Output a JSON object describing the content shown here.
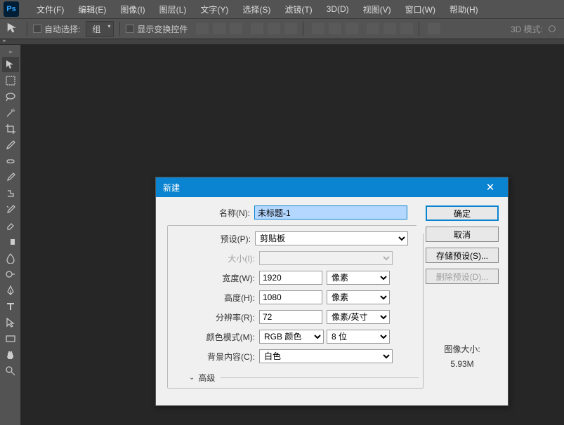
{
  "app": {
    "logo": "Ps"
  },
  "menu": [
    "文件(F)",
    "编辑(E)",
    "图像(I)",
    "图层(L)",
    "文字(Y)",
    "选择(S)",
    "滤镜(T)",
    "3D(D)",
    "视图(V)",
    "窗口(W)",
    "帮助(H)"
  ],
  "options": {
    "auto_select": "自动选择:",
    "group": "组",
    "show_transform": "显示变换控件",
    "mode_3d": "3D 模式:"
  },
  "dialog": {
    "title": "新建",
    "labels": {
      "name": "名称(N):",
      "preset": "预设(P):",
      "size": "大小(I):",
      "width": "宽度(W):",
      "height": "高度(H):",
      "resolution": "分辨率(R):",
      "color_mode": "颜色模式(M):",
      "background": "背景内容(C):",
      "advanced": "高级"
    },
    "values": {
      "name": "未标题-1",
      "preset": "剪贴板",
      "width": "1920",
      "height": "1080",
      "resolution": "72",
      "unit_px": "像素",
      "unit_ppi": "像素/英寸",
      "mode": "RGB 颜色",
      "depth": "8 位",
      "background": "白色"
    },
    "buttons": {
      "ok": "确定",
      "cancel": "取消",
      "save_preset": "存储预设(S)...",
      "delete_preset": "删除预设(D)..."
    },
    "image_size": {
      "label": "图像大小:",
      "value": "5.93M"
    }
  }
}
